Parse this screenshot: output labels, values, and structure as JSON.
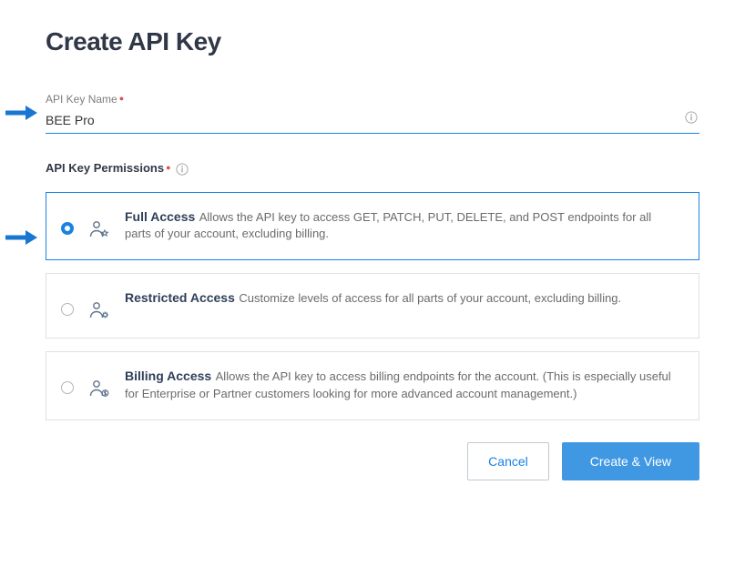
{
  "page": {
    "title": "Create API Key"
  },
  "form": {
    "name_label": "API Key Name",
    "name_value": "BEE Pro",
    "permissions_label": "API Key Permissions"
  },
  "options": [
    {
      "id": "full",
      "title": "Full Access",
      "desc": "Allows the API key to access GET, PATCH, PUT, DELETE, and POST endpoints for all parts of your account, excluding billing.",
      "selected": true
    },
    {
      "id": "restricted",
      "title": "Restricted Access",
      "desc": "Customize levels of access for all parts of your account, excluding billing.",
      "selected": false
    },
    {
      "id": "billing",
      "title": "Billing Access",
      "desc": "Allows the API key to access billing endpoints for the account. (This is especially useful for Enterprise or Partner customers looking for more advanced account management.)",
      "selected": false
    }
  ],
  "buttons": {
    "cancel": "Cancel",
    "submit": "Create & View"
  }
}
